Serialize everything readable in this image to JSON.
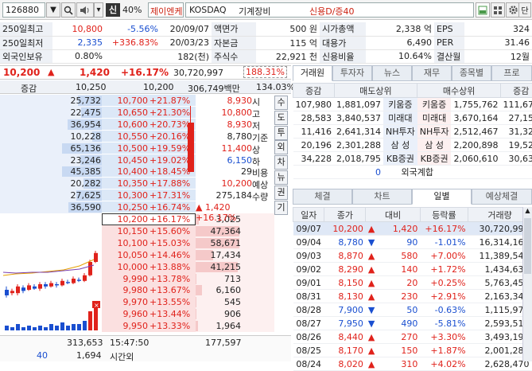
{
  "toolbar": {
    "code": "126880",
    "flag": "신",
    "margin": "40%",
    "name": "제이엔케이히",
    "market": "KOSDAQ",
    "sector": "기계장비",
    "credit": "신용D/증40",
    "menu": "단"
  },
  "info": {
    "rows": [
      [
        "250일최고",
        "10,800",
        "-5.56%",
        "20/09/07",
        "액면가",
        "500 원",
        "시가총액",
        "2,338 억",
        "EPS",
        "324"
      ],
      [
        "250일최저",
        "2,335",
        "+336.83%",
        "20/03/23",
        "자본금",
        "115 억",
        "대용가",
        "6,490",
        "PER",
        "31.46"
      ],
      [
        "외국인보유",
        "0.80%",
        "",
        "182(천)",
        "주식수",
        "22,921 천",
        "신용비율",
        "10.64%",
        "결산월",
        "12월"
      ]
    ]
  },
  "price": {
    "current": "10,200",
    "arrow": "▲",
    "change": "1,420",
    "rate": "+16.17%",
    "volume": "30,720,997",
    "turnover": "188.31%"
  },
  "ob_header": {
    "label": "증감",
    "ask": "10,250",
    "bid": "10,200",
    "amount": "306,749백만",
    "ratio": "134.03%"
  },
  "asks": [
    {
      "qty": "25,732",
      "price": "10,700",
      "pct": "+21.87%",
      "w": 60
    },
    {
      "qty": "22,475",
      "price": "10,650",
      "pct": "+21.30%",
      "w": 52
    },
    {
      "qty": "36,954",
      "price": "10,600",
      "pct": "+20.73%",
      "w": 86
    },
    {
      "qty": "10,228",
      "price": "10,550",
      "pct": "+20.16%",
      "w": 24
    },
    {
      "qty": "65,136",
      "price": "10,500",
      "pct": "+19.59%",
      "w": 100
    },
    {
      "qty": "23,246",
      "price": "10,450",
      "pct": "+19.02%",
      "w": 54
    },
    {
      "qty": "45,385",
      "price": "10,400",
      "pct": "+18.45%",
      "w": 100
    },
    {
      "qty": "20,282",
      "price": "10,350",
      "pct": "+17.88%",
      "w": 47
    },
    {
      "qty": "27,625",
      "price": "10,300",
      "pct": "+17.31%",
      "w": 64
    },
    {
      "qty": "36,590",
      "price": "10,250",
      "pct": "+16.74%",
      "w": 85
    }
  ],
  "bids": [
    {
      "qty": "3,025",
      "price": "10,200",
      "pct": "+16.17%",
      "w": 7
    },
    {
      "qty": "47,364",
      "price": "10,150",
      "pct": "+15.60%",
      "w": 100
    },
    {
      "qty": "58,671",
      "price": "10,100",
      "pct": "+15.03%",
      "w": 100
    },
    {
      "qty": "17,434",
      "price": "10,050",
      "pct": "+14.46%",
      "w": 40
    },
    {
      "qty": "41,215",
      "price": "10,000",
      "pct": "+13.88%",
      "w": 96
    },
    {
      "qty": "713",
      "price": "9,990",
      "pct": "+13.78%",
      "w": 2
    },
    {
      "qty": "6,160",
      "price": "9,980",
      "pct": "+13.67%",
      "w": 14
    },
    {
      "qty": "545",
      "price": "9,970",
      "pct": "+13.55%",
      "w": 1
    },
    {
      "qty": "906",
      "price": "9,960",
      "pct": "+13.44%",
      "w": 2
    },
    {
      "qty": "1,964",
      "price": "9,950",
      "pct": "+13.33%",
      "w": 5
    }
  ],
  "summary": [
    {
      "label": "시",
      "value": "8,930",
      "cls": "red"
    },
    {
      "label": "고",
      "value": "10,800",
      "cls": "red"
    },
    {
      "label": "저",
      "value": "8,930",
      "cls": "red"
    },
    {
      "label": "기준",
      "value": "8,780",
      "cls": ""
    },
    {
      "label": "상",
      "value": "11,400",
      "cls": "red"
    },
    {
      "label": "하",
      "value": "6,150",
      "cls": "blue"
    },
    {
      "label": "비용",
      "value": "29",
      "cls": ""
    },
    {
      "label": "예상",
      "value": "10,200",
      "cls": "red"
    },
    {
      "label": "수량",
      "value": "275,184",
      "cls": ""
    },
    {
      "label": "",
      "value": "▲ 1,420 +16.17%",
      "cls": "red"
    }
  ],
  "side_buttons": [
    "수",
    "도",
    "투",
    "외",
    "차",
    "뉴",
    "권",
    "기"
  ],
  "footer": {
    "ask_total": "313,653",
    "time": "15:47:50",
    "bid_total": "177,597",
    "diff": "40",
    "qty": "1,694",
    "label": "시간외"
  },
  "right_tabs": [
    "거래원",
    "투자자",
    "뉴스",
    "재무",
    "종목별",
    "프로"
  ],
  "broker_header": [
    "증감",
    "매도상위",
    "",
    "매수상위",
    "증감"
  ],
  "brokers": [
    [
      "107,980",
      "1,881,097",
      "키움증",
      "키움증",
      "1,755,762",
      "111,679"
    ],
    [
      "28,583",
      "3,840,537",
      "미래대",
      "미래대",
      "3,670,164",
      "27,159"
    ],
    [
      "11,416",
      "2,641,314",
      "NH투자",
      "NH투자",
      "2,512,467",
      "31,323"
    ],
    [
      "20,196",
      "2,301,288",
      "삼 성",
      "삼 성",
      "2,200,898",
      "19,527"
    ],
    [
      "34,228",
      "2,018,795",
      "KB증권",
      "KB증권",
      "2,060,610",
      "30,637"
    ]
  ],
  "foreign": {
    "left": "0",
    "label": "외국계합",
    "right": "0"
  },
  "lower_tabs": [
    "체결",
    "차트",
    "일별",
    "예상체결"
  ],
  "daily_header": [
    "일자",
    "종가",
    "대비",
    "등락률",
    "거래량"
  ],
  "daily": [
    [
      "09/07",
      "10,200",
      "▲",
      "1,420",
      "+16.17%",
      "30,720,997",
      "red"
    ],
    [
      "09/04",
      "8,780",
      "▼",
      "90",
      "-1.01%",
      "16,314,168",
      "blue"
    ],
    [
      "09/03",
      "8,870",
      "▲",
      "580",
      "+7.00%",
      "11,389,547",
      "red"
    ],
    [
      "09/02",
      "8,290",
      "▲",
      "140",
      "+1.72%",
      "1,434,636",
      "red"
    ],
    [
      "09/01",
      "8,150",
      "▲",
      "20",
      "+0.25%",
      "5,763,457",
      "red"
    ],
    [
      "08/31",
      "8,130",
      "▲",
      "230",
      "+2.91%",
      "2,163,344",
      "red"
    ],
    [
      "08/28",
      "7,900",
      "▼",
      "50",
      "-0.63%",
      "1,115,979",
      "blue"
    ],
    [
      "08/27",
      "7,950",
      "▼",
      "490",
      "-5.81%",
      "2,593,513",
      "blue"
    ],
    [
      "08/26",
      "8,440",
      "▲",
      "270",
      "+3.30%",
      "3,493,198",
      "red"
    ],
    [
      "08/25",
      "8,170",
      "▲",
      "150",
      "+1.87%",
      "2,001,284",
      "red"
    ],
    [
      "08/24",
      "8,020",
      "▲",
      "310",
      "+4.02%",
      "2,628,470",
      "red"
    ]
  ],
  "colors": {
    "up": "#e0221b",
    "down": "#1a4fd0"
  }
}
